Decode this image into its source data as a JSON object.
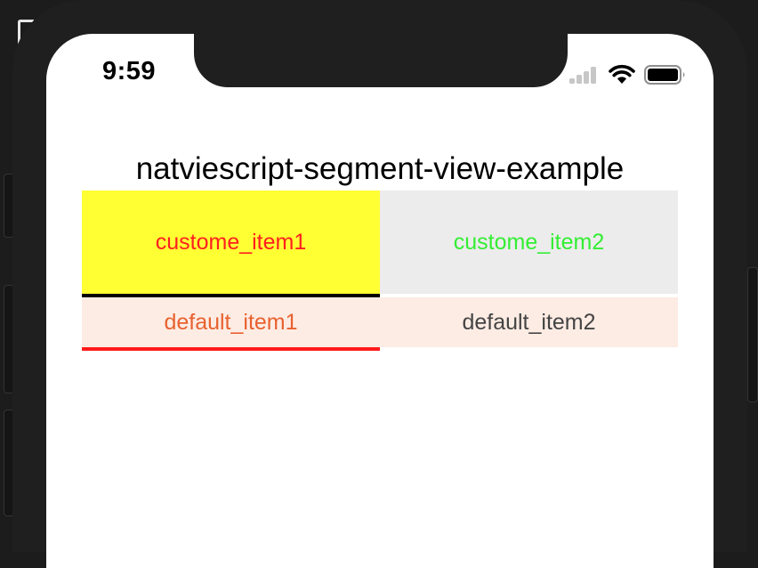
{
  "status_bar": {
    "time": "9:59"
  },
  "page": {
    "title": "natviescript-segment-view-example"
  },
  "custom_segment": {
    "items": [
      "custome_item1",
      "custome_item2"
    ],
    "selected_index": 0,
    "colors": {
      "item1_background": "#ffff33",
      "item1_text": "#ff1f1f",
      "item2_background": "#ececec",
      "item2_text": "#33ee33",
      "selected_indicator": "#000000"
    }
  },
  "default_segment": {
    "items": [
      "default_item1",
      "default_item2"
    ],
    "selected_index": 0,
    "colors": {
      "background": "#fdece4",
      "selected_text": "#e8612e",
      "unselected_text": "#444444",
      "selected_indicator": "#ff1a1a"
    }
  }
}
